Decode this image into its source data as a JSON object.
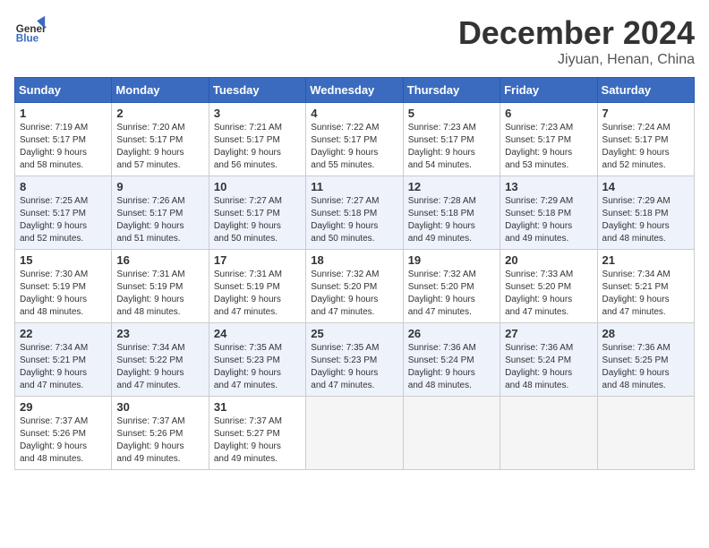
{
  "logo": {
    "line1": "General",
    "line2": "Blue"
  },
  "title": "December 2024",
  "location": "Jiyuan, Henan, China",
  "weekdays": [
    "Sunday",
    "Monday",
    "Tuesday",
    "Wednesday",
    "Thursday",
    "Friday",
    "Saturday"
  ],
  "weeks": [
    [
      {
        "day": "1",
        "info": "Sunrise: 7:19 AM\nSunset: 5:17 PM\nDaylight: 9 hours\nand 58 minutes."
      },
      {
        "day": "2",
        "info": "Sunrise: 7:20 AM\nSunset: 5:17 PM\nDaylight: 9 hours\nand 57 minutes."
      },
      {
        "day": "3",
        "info": "Sunrise: 7:21 AM\nSunset: 5:17 PM\nDaylight: 9 hours\nand 56 minutes."
      },
      {
        "day": "4",
        "info": "Sunrise: 7:22 AM\nSunset: 5:17 PM\nDaylight: 9 hours\nand 55 minutes."
      },
      {
        "day": "5",
        "info": "Sunrise: 7:23 AM\nSunset: 5:17 PM\nDaylight: 9 hours\nand 54 minutes."
      },
      {
        "day": "6",
        "info": "Sunrise: 7:23 AM\nSunset: 5:17 PM\nDaylight: 9 hours\nand 53 minutes."
      },
      {
        "day": "7",
        "info": "Sunrise: 7:24 AM\nSunset: 5:17 PM\nDaylight: 9 hours\nand 52 minutes."
      }
    ],
    [
      {
        "day": "8",
        "info": "Sunrise: 7:25 AM\nSunset: 5:17 PM\nDaylight: 9 hours\nand 52 minutes."
      },
      {
        "day": "9",
        "info": "Sunrise: 7:26 AM\nSunset: 5:17 PM\nDaylight: 9 hours\nand 51 minutes."
      },
      {
        "day": "10",
        "info": "Sunrise: 7:27 AM\nSunset: 5:17 PM\nDaylight: 9 hours\nand 50 minutes."
      },
      {
        "day": "11",
        "info": "Sunrise: 7:27 AM\nSunset: 5:18 PM\nDaylight: 9 hours\nand 50 minutes."
      },
      {
        "day": "12",
        "info": "Sunrise: 7:28 AM\nSunset: 5:18 PM\nDaylight: 9 hours\nand 49 minutes."
      },
      {
        "day": "13",
        "info": "Sunrise: 7:29 AM\nSunset: 5:18 PM\nDaylight: 9 hours\nand 49 minutes."
      },
      {
        "day": "14",
        "info": "Sunrise: 7:29 AM\nSunset: 5:18 PM\nDaylight: 9 hours\nand 48 minutes."
      }
    ],
    [
      {
        "day": "15",
        "info": "Sunrise: 7:30 AM\nSunset: 5:19 PM\nDaylight: 9 hours\nand 48 minutes."
      },
      {
        "day": "16",
        "info": "Sunrise: 7:31 AM\nSunset: 5:19 PM\nDaylight: 9 hours\nand 48 minutes."
      },
      {
        "day": "17",
        "info": "Sunrise: 7:31 AM\nSunset: 5:19 PM\nDaylight: 9 hours\nand 47 minutes."
      },
      {
        "day": "18",
        "info": "Sunrise: 7:32 AM\nSunset: 5:20 PM\nDaylight: 9 hours\nand 47 minutes."
      },
      {
        "day": "19",
        "info": "Sunrise: 7:32 AM\nSunset: 5:20 PM\nDaylight: 9 hours\nand 47 minutes."
      },
      {
        "day": "20",
        "info": "Sunrise: 7:33 AM\nSunset: 5:20 PM\nDaylight: 9 hours\nand 47 minutes."
      },
      {
        "day": "21",
        "info": "Sunrise: 7:34 AM\nSunset: 5:21 PM\nDaylight: 9 hours\nand 47 minutes."
      }
    ],
    [
      {
        "day": "22",
        "info": "Sunrise: 7:34 AM\nSunset: 5:21 PM\nDaylight: 9 hours\nand 47 minutes."
      },
      {
        "day": "23",
        "info": "Sunrise: 7:34 AM\nSunset: 5:22 PM\nDaylight: 9 hours\nand 47 minutes."
      },
      {
        "day": "24",
        "info": "Sunrise: 7:35 AM\nSunset: 5:23 PM\nDaylight: 9 hours\nand 47 minutes."
      },
      {
        "day": "25",
        "info": "Sunrise: 7:35 AM\nSunset: 5:23 PM\nDaylight: 9 hours\nand 47 minutes."
      },
      {
        "day": "26",
        "info": "Sunrise: 7:36 AM\nSunset: 5:24 PM\nDaylight: 9 hours\nand 48 minutes."
      },
      {
        "day": "27",
        "info": "Sunrise: 7:36 AM\nSunset: 5:24 PM\nDaylight: 9 hours\nand 48 minutes."
      },
      {
        "day": "28",
        "info": "Sunrise: 7:36 AM\nSunset: 5:25 PM\nDaylight: 9 hours\nand 48 minutes."
      }
    ],
    [
      {
        "day": "29",
        "info": "Sunrise: 7:37 AM\nSunset: 5:26 PM\nDaylight: 9 hours\nand 48 minutes."
      },
      {
        "day": "30",
        "info": "Sunrise: 7:37 AM\nSunset: 5:26 PM\nDaylight: 9 hours\nand 49 minutes."
      },
      {
        "day": "31",
        "info": "Sunrise: 7:37 AM\nSunset: 5:27 PM\nDaylight: 9 hours\nand 49 minutes."
      },
      {
        "day": "",
        "info": ""
      },
      {
        "day": "",
        "info": ""
      },
      {
        "day": "",
        "info": ""
      },
      {
        "day": "",
        "info": ""
      }
    ]
  ]
}
